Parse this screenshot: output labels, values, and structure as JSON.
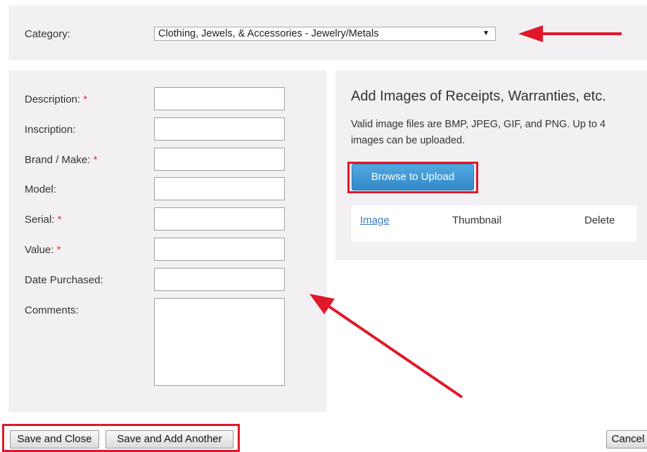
{
  "category": {
    "label": "Category:",
    "selected": "Clothing, Jewels, & Accessories - Jewelry/Metals",
    "arrow_glyph": "▼"
  },
  "form": {
    "fields": [
      {
        "label": "Description:",
        "required": true,
        "value": ""
      },
      {
        "label": "Inscription:",
        "required": false,
        "value": ""
      },
      {
        "label": "Brand / Make:",
        "required": true,
        "value": ""
      },
      {
        "label": "Model:",
        "required": false,
        "value": ""
      },
      {
        "label": "Serial:",
        "required": true,
        "value": ""
      },
      {
        "label": "Value:",
        "required": true,
        "value": ""
      },
      {
        "label": "Date Purchased:",
        "required": false,
        "value": ""
      }
    ],
    "comments_label": "Comments:",
    "required_mark": "*"
  },
  "images": {
    "title": "Add Images of Receipts, Warranties, etc.",
    "description": "Valid image files are BMP, JPEG, GIF, and PNG. Up to 4 images can be uploaded.",
    "browse_label": "Browse to Upload",
    "columns": [
      "Image",
      "Thumbnail",
      "Delete"
    ]
  },
  "footer": {
    "save_close": "Save and Close",
    "save_add": "Save and Add Another",
    "cancel": "Cancel"
  },
  "colors": {
    "panel_bg": "#f3f0f3",
    "annotation_red": "#e0182a",
    "primary_blue": "#3389c8",
    "required_red": "#e03030",
    "link_blue": "#3d7bbf"
  }
}
